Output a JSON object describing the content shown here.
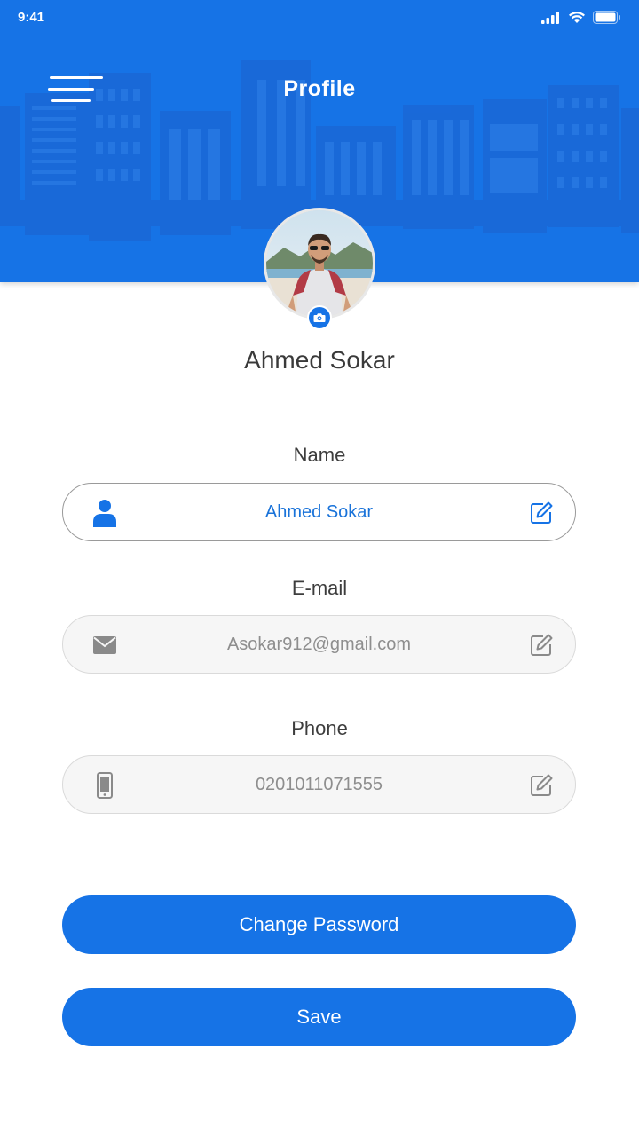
{
  "status_bar": {
    "time": "9:41"
  },
  "header": {
    "title": "Profile"
  },
  "profile": {
    "name": "Ahmed Sokar"
  },
  "fields": {
    "name": {
      "label": "Name",
      "value": "Ahmed Sokar",
      "icon": "user-icon"
    },
    "email": {
      "label": "E-mail",
      "value": "Asokar912@gmail.com",
      "icon": "envelope-icon"
    },
    "phone": {
      "label": "Phone",
      "value": "0201011071555",
      "icon": "mobile-phone-icon"
    }
  },
  "buttons": {
    "change_password": "Change Password",
    "save": "Save"
  },
  "colors": {
    "primary": "#1673E6",
    "text_dark": "#3a3a3a",
    "text_muted": "#8e8e8e",
    "field_bg": "#f6f6f6"
  }
}
